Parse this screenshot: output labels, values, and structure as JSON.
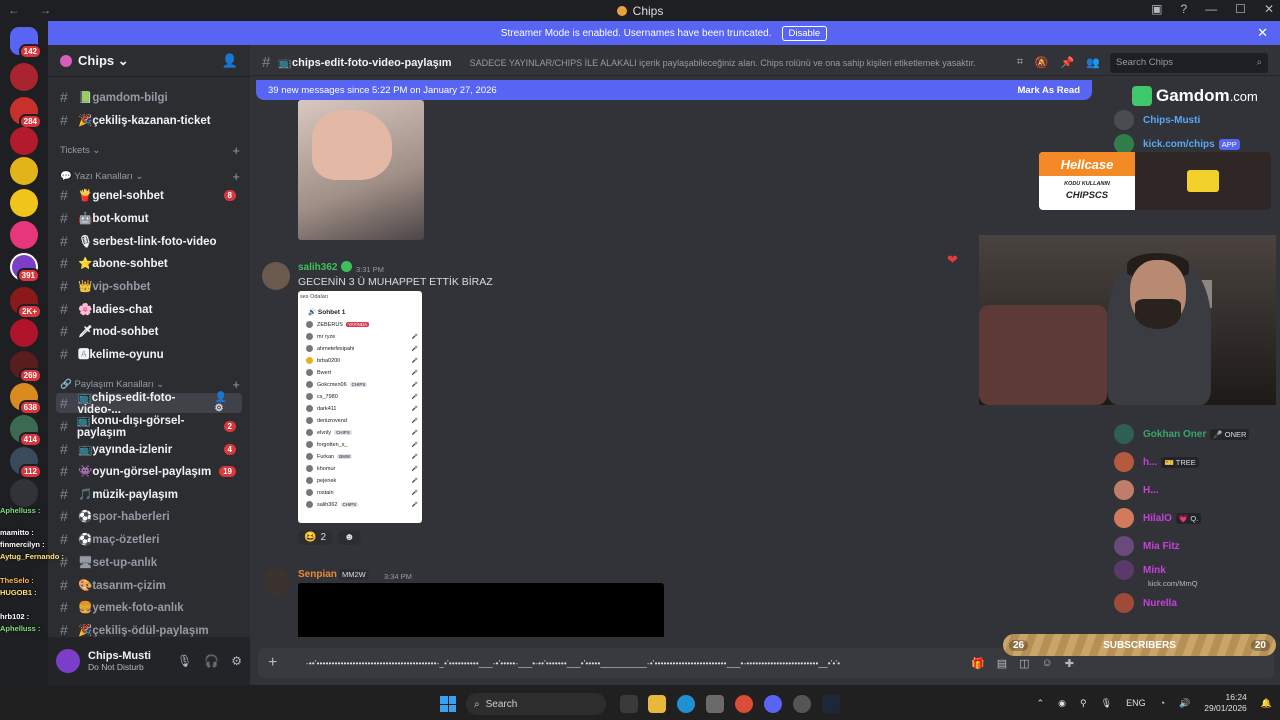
{
  "window": {
    "title": "Chips",
    "nav": "← →",
    "controls": [
      "▣",
      "?",
      "—",
      "☐",
      "✕"
    ]
  },
  "streamer_banner": {
    "text": "Streamer Mode is enabled. Usernames have been truncated.",
    "button": "Disable",
    "close": "✕"
  },
  "server": {
    "name": "Chips ⌄"
  },
  "guild_badges": [
    "142",
    "284",
    "",
    "",
    "",
    "391",
    "2K+",
    "269",
    "638",
    "414",
    "112"
  ],
  "channels": {
    "top": [
      {
        "label": "📗gamdom-bilgi",
        "unread": false
      },
      {
        "label": "🎉çekiliş-kazanan-ticket",
        "unread": true
      }
    ],
    "cat_tickets": "Tickets ⌄",
    "cat_text": "💬 Yazı Kanalları ⌄",
    "text": [
      {
        "label": "🍟genel-sohbet",
        "badge": "8"
      },
      {
        "label": "🤖bot-komut",
        "badge": ""
      },
      {
        "label": "🎙serbest-link-foto-video",
        "badge": ""
      },
      {
        "label": "⭐abone-sohbet",
        "badge": ""
      },
      {
        "label": "👑vip-sohbet",
        "badge": ""
      },
      {
        "label": "🌸ladies-chat",
        "badge": ""
      },
      {
        "label": "🗡mod-sohbet",
        "badge": ""
      },
      {
        "label": "🅰kelime-oyunu",
        "badge": ""
      }
    ],
    "cat_share": "🔗 Paylaşım Kanalları ⌄",
    "share": [
      {
        "label": "📺chips-edit-foto-video-...",
        "badge": ""
      },
      {
        "label": "📺konu-dışı-görsel-paylaşım",
        "badge": "2"
      },
      {
        "label": "📺yayında-izlenir",
        "badge": "4"
      },
      {
        "label": "👾oyun-görsel-paylaşım",
        "badge": "19"
      },
      {
        "label": "🎵müzik-paylaşım",
        "badge": ""
      },
      {
        "label": "⚽spor-haberleri",
        "badge": ""
      },
      {
        "label": "⚽maç-özetleri",
        "badge": ""
      },
      {
        "label": "🖥set-up-anlık",
        "badge": ""
      },
      {
        "label": "🎨tasarım-çizim",
        "badge": ""
      },
      {
        "label": "🍔yemek-foto-anlık",
        "badge": ""
      },
      {
        "label": "🎉çekiliş-ödül-paylaşım",
        "badge": ""
      }
    ]
  },
  "user_panel": {
    "name": "Chips-Musti",
    "status": "Do Not Disturb"
  },
  "chat_overlay": [
    "Aphelluss :",
    "mamitto :",
    "finmercilyn :",
    "Aytug_Fernando :",
    "TheSelo :",
    "HUGOB1 :",
    "hrb102 :",
    "Aphelluss :"
  ],
  "channel_header": {
    "title": "📺chips-edit-foto-video-paylaşım",
    "topic": "SADECE YAYINLAR/CHIPS İLE ALAKALI içerik paylaşabileceğiniz alan. Chips rolünü ve ona sahip kişileri etiketlemek yasaktır.",
    "search_placeholder": "Search Chips"
  },
  "new_messages_bar": {
    "text": "39 new messages since 5:22 PM on January 27, 2026",
    "action": "Mark As Read"
  },
  "messages": [
    {
      "author": "salih362",
      "time": "3:31 PM",
      "text": "GECENİN 3 Ü MUHAPPET ETTİK BİRAZ",
      "screenshot": {
        "title": "ses Odaları",
        "room": "🔊 Sohbet 1",
        "users": [
          {
            "name": "ZEBERUS",
            "tag": "YAYINDA"
          },
          {
            "name": "mr ryze",
            "tag": ""
          },
          {
            "name": "ahmetefesipahi",
            "tag": ""
          },
          {
            "name": "brba0200",
            "tag": ""
          },
          {
            "name": "Bwert",
            "tag": ""
          },
          {
            "name": "Gokcmen06",
            "tag": "CHIPS"
          },
          {
            "name": "cs_7980",
            "tag": ""
          },
          {
            "name": "dark411",
            "tag": ""
          },
          {
            "name": "denizrovend",
            "tag": ""
          },
          {
            "name": "elvnly",
            "tag": "CHIPS"
          },
          {
            "name": "forgotten_s_",
            "tag": ""
          },
          {
            "name": "Furkan",
            "tag": "BMW"
          },
          {
            "name": "khomur",
            "tag": ""
          },
          {
            "name": "pejenek",
            "tag": ""
          },
          {
            "name": "rostain",
            "tag": ""
          },
          {
            "name": "salih362",
            "tag": "CHIPS"
          }
        ]
      },
      "reactions": [
        {
          "emoji": "😆",
          "count": "2"
        },
        {
          "emoji": "☻",
          "count": ""
        }
      ]
    },
    {
      "author": "Senpian",
      "role": "MM2W",
      "time": "3:34 PM"
    }
  ],
  "composer": {
    "plus": "+",
    "draft": "-••'••••••••••••••••••••••••••••••••••••••••-_•'••••••••••___-•'•••••-___•-••'•••••••___•'•••••__________-•'••••••••••••••••••••••••___•-••••••••••••••••••••••••__•'•'•"
  },
  "members": [
    {
      "name": "Chips-Musti",
      "color": "#57a9f5",
      "tag": "",
      "sub": ""
    },
    {
      "name": "kick.com/chips",
      "color": "#57a9f5",
      "tag": "APP",
      "sub": ""
    },
    {
      "name": "Gokhan Oner",
      "color": "#3aa56b",
      "tag": "🎤 ONER",
      "sub": ""
    },
    {
      "name": "h...",
      "color": "#c542d8",
      "tag": "🎫 TREE",
      "sub": ""
    },
    {
      "name": "H...",
      "color": "#c542d8",
      "tag": "",
      "sub": ""
    },
    {
      "name": "HilalO",
      "color": "#c542d8",
      "tag": "💗 Q.",
      "sub": ""
    },
    {
      "name": "Mia Fitz",
      "color": "#c542d8",
      "tag": "",
      "sub": ""
    },
    {
      "name": "Mink",
      "color": "#c542d8",
      "tag": "",
      "sub": "kick.com/MmQ"
    },
    {
      "name": "Nurella",
      "color": "#c542d8",
      "tag": "",
      "sub": ""
    }
  ],
  "overlays": {
    "gamdom": {
      "brand": "Gamdom",
      "suffix": ".com"
    },
    "hellcase": {
      "brand": "Hellcase",
      "line1": "KODU KULLANIN",
      "code": "CHIPSCS"
    },
    "subscribers": {
      "left": "26",
      "label": "SUBSCRIBERS",
      "right": "20"
    }
  },
  "taskbar": {
    "search": "Search",
    "lang": "ENG",
    "time": "16:24",
    "date": "29/01/2026"
  }
}
